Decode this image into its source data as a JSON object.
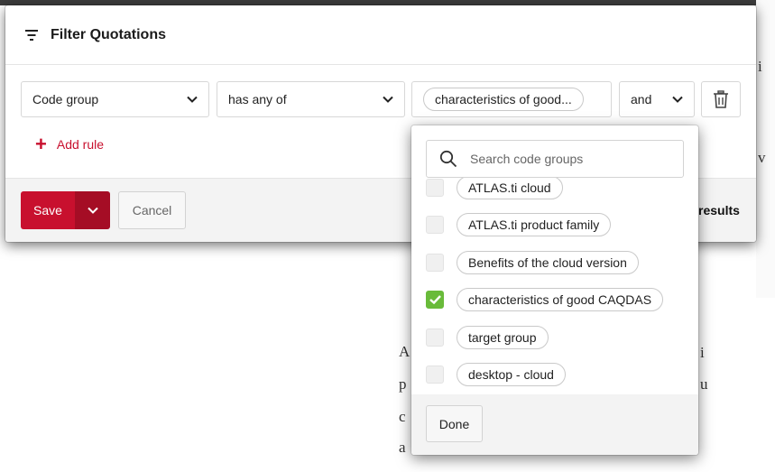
{
  "dialog": {
    "title": "Filter Quotations",
    "rule": {
      "field": "Code group",
      "operator": "has any of",
      "value_chip": "characteristics of good...",
      "combinator": "and"
    },
    "add_rule_label": "Add rule",
    "footer": {
      "save_label": "Save",
      "cancel_label": "Cancel",
      "results_label": "results"
    }
  },
  "dropdown": {
    "search_placeholder": "Search code groups",
    "options": [
      {
        "label": "ATLAS.ti cloud",
        "checked": false
      },
      {
        "label": "ATLAS.ti product family",
        "checked": false
      },
      {
        "label": "Benefits of the cloud version",
        "checked": false
      },
      {
        "label": "characteristics of good CAQDAS",
        "checked": true
      },
      {
        "label": "target group",
        "checked": false
      },
      {
        "label": "desktop - cloud",
        "checked": false
      }
    ],
    "done_label": "Done"
  },
  "colors": {
    "brand_red": "#c8102e",
    "check_green": "#69bb3a"
  },
  "icons": [
    "filter-icon",
    "chevron-down-icon",
    "trash-icon",
    "plus-icon",
    "search-icon",
    "check-icon"
  ]
}
